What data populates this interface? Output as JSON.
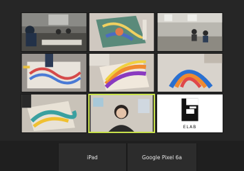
{
  "participants": [
    {
      "id": "p1",
      "icon": "classroom-video"
    },
    {
      "id": "p2",
      "icon": "painting-video"
    },
    {
      "id": "p3",
      "icon": "office-video"
    },
    {
      "id": "p4",
      "icon": "drawing-video"
    },
    {
      "id": "p5",
      "icon": "drawing-video"
    },
    {
      "id": "p6",
      "icon": "drawing-video"
    },
    {
      "id": "p7",
      "icon": "drawing-video"
    },
    {
      "id": "p8",
      "icon": "person-video"
    },
    {
      "id": "p9",
      "icon": "elab-logo"
    }
  ],
  "logo": {
    "text": "ELAB"
  },
  "bottom_tabs": [
    {
      "label": "iPad"
    },
    {
      "label": "Google Pixel 6a"
    }
  ],
  "colors": {
    "active_border": "#c9e24c",
    "background": "#262626"
  }
}
